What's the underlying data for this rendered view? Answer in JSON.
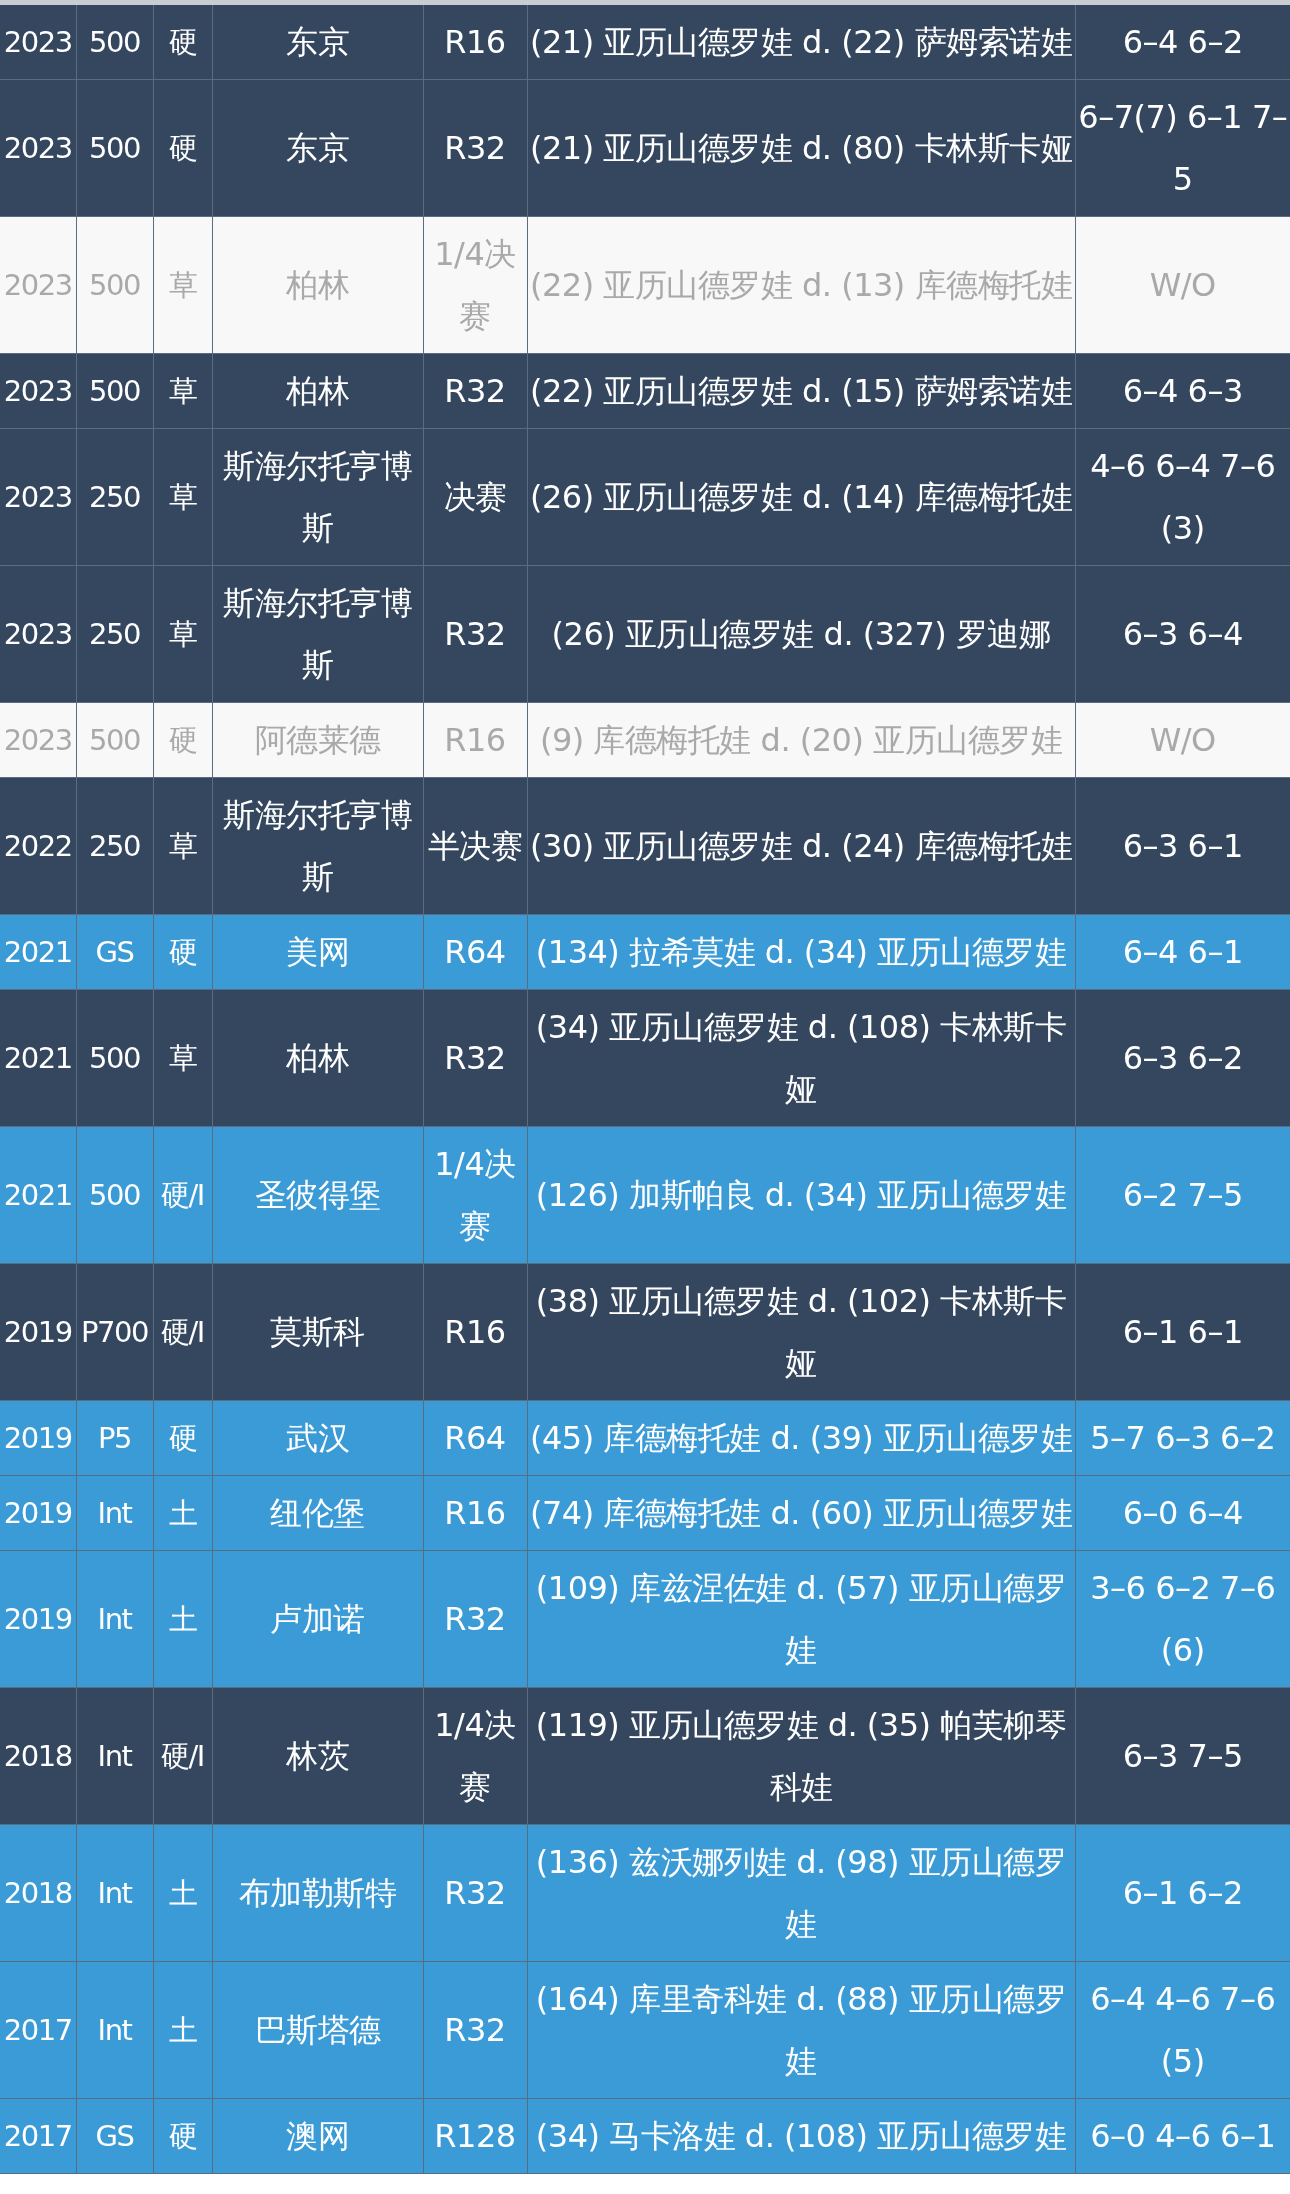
{
  "rows": [
    {
      "kind": "win",
      "year": "2023",
      "tier": "500",
      "surface": "硬",
      "event": "东京",
      "round": "R16",
      "match": "(21) 亚历山德罗娃 d. (22) 萨姆索诺娃",
      "score": "6–4 6–2"
    },
    {
      "kind": "win",
      "year": "2023",
      "tier": "500",
      "surface": "硬",
      "event": "东京",
      "round": "R32",
      "match": "(21) 亚历山德罗娃 d. (80) 卡林斯卡娅",
      "score": "6–7(7) 6–1 7–5"
    },
    {
      "kind": "walkover",
      "year": "2023",
      "tier": "500",
      "surface": "草",
      "event": "柏林",
      "round": "1/4决赛",
      "match": "(22) 亚历山德罗娃 d. (13) 库德梅托娃",
      "score": "W/O"
    },
    {
      "kind": "win",
      "year": "2023",
      "tier": "500",
      "surface": "草",
      "event": "柏林",
      "round": "R32",
      "match": "(22) 亚历山德罗娃 d. (15) 萨姆索诺娃",
      "score": "6–4 6–3"
    },
    {
      "kind": "win",
      "year": "2023",
      "tier": "250",
      "surface": "草",
      "event": "斯海尔托亨博斯",
      "round": "决赛",
      "match": "(26) 亚历山德罗娃 d. (14) 库德梅托娃",
      "score": "4–6 6–4 7–6(3)"
    },
    {
      "kind": "win",
      "year": "2023",
      "tier": "250",
      "surface": "草",
      "event": "斯海尔托亨博斯",
      "round": "R32",
      "match": "(26) 亚历山德罗娃 d. (327) 罗迪娜",
      "score": "6–3 6–4"
    },
    {
      "kind": "walkover",
      "year": "2023",
      "tier": "500",
      "surface": "硬",
      "event": "阿德莱德",
      "round": "R16",
      "match": "(9) 库德梅托娃 d. (20) 亚历山德罗娃",
      "score": "W/O"
    },
    {
      "kind": "win",
      "year": "2022",
      "tier": "250",
      "surface": "草",
      "event": "斯海尔托亨博斯",
      "round": "半决赛",
      "match": "(30) 亚历山德罗娃 d. (24) 库德梅托娃",
      "score": "6–3 6–1"
    },
    {
      "kind": "loss",
      "year": "2021",
      "tier": "GS",
      "surface": "硬",
      "event": "美网",
      "round": "R64",
      "match": "(134) 拉希莫娃 d. (34) 亚历山德罗娃",
      "score": "6–4 6–1"
    },
    {
      "kind": "win",
      "year": "2021",
      "tier": "500",
      "surface": "草",
      "event": "柏林",
      "round": "R32",
      "match": "(34) 亚历山德罗娃 d. (108) 卡林斯卡娅",
      "score": "6–3 6–2"
    },
    {
      "kind": "loss",
      "year": "2021",
      "tier": "500",
      "surface": "硬/I",
      "event": "圣彼得堡",
      "round": "1/4决赛",
      "match": "(126) 加斯帕良 d. (34) 亚历山德罗娃",
      "score": "6–2 7–5"
    },
    {
      "kind": "win",
      "year": "2019",
      "tier": "P700",
      "surface": "硬/I",
      "event": "莫斯科",
      "round": "R16",
      "match": "(38) 亚历山德罗娃 d. (102) 卡林斯卡娅",
      "score": "6–1 6–1"
    },
    {
      "kind": "loss",
      "year": "2019",
      "tier": "P5",
      "surface": "硬",
      "event": "武汉",
      "round": "R64",
      "match": "(45) 库德梅托娃 d. (39) 亚历山德罗娃",
      "score": "5–7 6–3 6–2"
    },
    {
      "kind": "loss",
      "year": "2019",
      "tier": "Int",
      "surface": "土",
      "event": "纽伦堡",
      "round": "R16",
      "match": "(74) 库德梅托娃 d. (60) 亚历山德罗娃",
      "score": "6–0 6–4"
    },
    {
      "kind": "loss",
      "year": "2019",
      "tier": "Int",
      "surface": "土",
      "event": "卢加诺",
      "round": "R32",
      "match": "(109) 库兹涅佐娃 d. (57) 亚历山德罗娃",
      "score": "3–6 6–2 7–6(6)"
    },
    {
      "kind": "win",
      "year": "2018",
      "tier": "Int",
      "surface": "硬/I",
      "event": "林茨",
      "round": "1/4决赛",
      "match": "(119) 亚历山德罗娃 d. (35) 帕芙柳琴科娃",
      "score": "6–3 7–5"
    },
    {
      "kind": "loss",
      "year": "2018",
      "tier": "Int",
      "surface": "土",
      "event": "布加勒斯特",
      "round": "R32",
      "match": "(136) 兹沃娜列娃 d. (98) 亚历山德罗娃",
      "score": "6–1 6–2"
    },
    {
      "kind": "loss",
      "year": "2017",
      "tier": "Int",
      "surface": "土",
      "event": "巴斯塔德",
      "round": "R32",
      "match": "(164) 库里奇科娃 d. (88) 亚历山德罗娃",
      "score": "6–4 4–6 7–6(5)"
    },
    {
      "kind": "loss",
      "year": "2017",
      "tier": "GS",
      "surface": "硬",
      "event": "澳网",
      "round": "R128",
      "match": "(34) 马卡洛娃 d. (108) 亚历山德罗娃",
      "score": "6–0 4–6 6–1"
    }
  ]
}
